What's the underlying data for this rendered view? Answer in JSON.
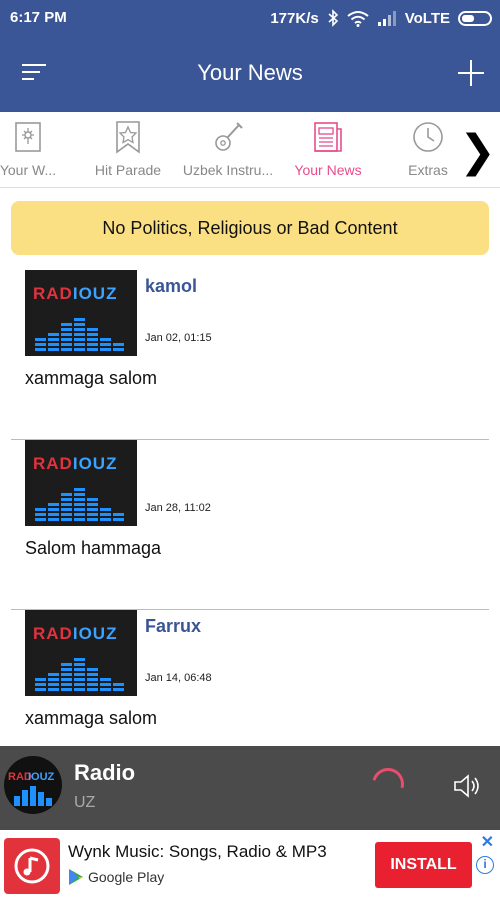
{
  "status_bar": {
    "time": "6:17 PM",
    "network_speed": "177K/s",
    "network_type": "VoLTE",
    "icons": [
      "bluetooth-icon",
      "wifi-icon",
      "signal-icon",
      "battery-icon"
    ]
  },
  "app_bar": {
    "title": "Your News",
    "menu_icon": "hamburger-icon",
    "add_icon": "plus-icon"
  },
  "tabs": [
    {
      "label": "Your W...",
      "icon": "flower-frame-icon",
      "active": false
    },
    {
      "label": "Hit Parade",
      "icon": "star-bookmark-icon",
      "active": false
    },
    {
      "label": "Uzbek Instru...",
      "icon": "guitar-icon",
      "active": false
    },
    {
      "label": "Your News",
      "icon": "newspaper-icon",
      "active": true
    },
    {
      "label": "Extras",
      "icon": "clock-icon",
      "active": false
    }
  ],
  "tab_scroll_icon": "chevron-right-icon",
  "banner": {
    "text": "No Politics, Religious or Bad Content"
  },
  "posts": [
    {
      "author": "kamol",
      "date": "Jan 02, 01:15",
      "text": "xammaga salom"
    },
    {
      "author": "",
      "date": "Jan 28, 11:02",
      "text": "Salom hammaga"
    },
    {
      "author": "Farrux",
      "date": "Jan 14, 06:48",
      "text": "xammaga salom"
    }
  ],
  "thumbnail_logo": {
    "left": "RAD",
    "right": "IOUZ"
  },
  "player": {
    "title": "Radio",
    "subtitle": "UZ",
    "status": "loading",
    "volume_icon": "speaker-icon"
  },
  "ad": {
    "title": "Wynk Music: Songs, Radio & MP3",
    "store": "Google Play",
    "install_label": "INSTALL",
    "close_label": "✕",
    "info_label": "i"
  },
  "colors": {
    "primary": "#3b5696",
    "accent": "#e84c8b",
    "banner": "#fbe083",
    "player_bg": "#4b4b4b",
    "install": "#e8202f"
  }
}
